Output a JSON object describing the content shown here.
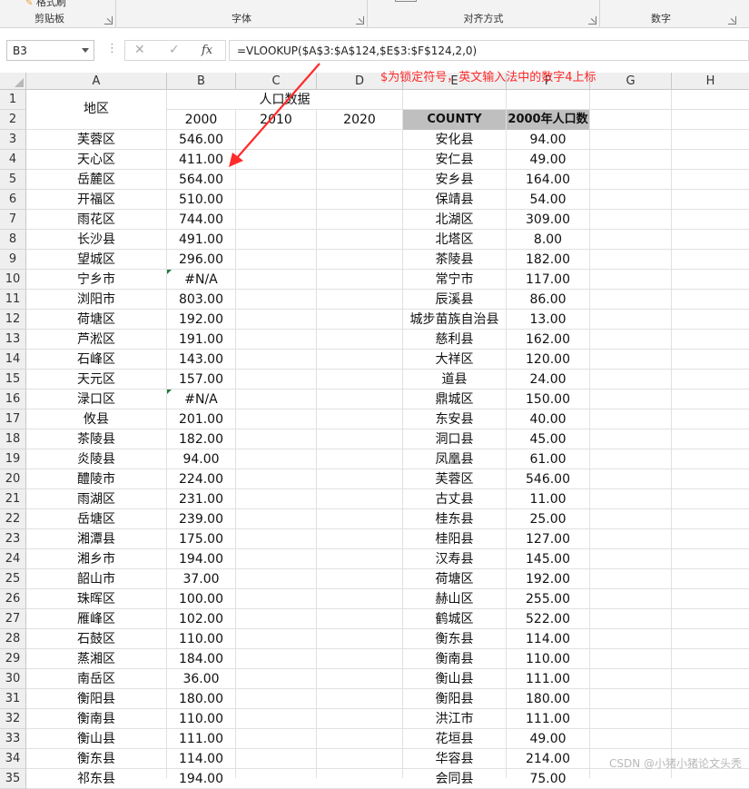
{
  "ribbon": {
    "clipboard_top": "格式刷",
    "groups": [
      {
        "label": "剪贴板"
      },
      {
        "label": "字体"
      },
      {
        "label": "对齐方式"
      },
      {
        "label": "数字"
      }
    ]
  },
  "formula_bar": {
    "name_box": "B3",
    "formula": "=VLOOKUP($A$3:$A$124,$E$3:$F$124,2,0)",
    "cancel_icon": "✕",
    "enter_icon": "✓",
    "fx_label": "fx"
  },
  "annotation": "$为锁定符号，英文输入法中的数字4上标",
  "columns": [
    "A",
    "B",
    "C",
    "D",
    "E",
    "F",
    "G",
    "H"
  ],
  "rows": [
    "1",
    "2",
    "3",
    "4",
    "5",
    "6",
    "7",
    "8",
    "9",
    "10",
    "11",
    "12",
    "13",
    "14",
    "15",
    "16",
    "17",
    "18",
    "19",
    "20",
    "21",
    "22",
    "23",
    "24",
    "25",
    "26",
    "27",
    "28",
    "29",
    "30",
    "31",
    "32",
    "33",
    "34",
    "35"
  ],
  "headers": {
    "region": "地区",
    "population_data": "人口数据",
    "year_2000": "2000",
    "year_2010": "2010",
    "year_2020": "2020",
    "county": "COUNTY",
    "pop_2000": "2000年人口数"
  },
  "left_table": [
    [
      "芙蓉区",
      "546.00"
    ],
    [
      "天心区",
      "411.00"
    ],
    [
      "岳麓区",
      "564.00"
    ],
    [
      "开福区",
      "510.00"
    ],
    [
      "雨花区",
      "744.00"
    ],
    [
      "长沙县",
      "491.00"
    ],
    [
      "望城区",
      "296.00"
    ],
    [
      "宁乡市",
      "#N/A"
    ],
    [
      "浏阳市",
      "803.00"
    ],
    [
      "荷塘区",
      "192.00"
    ],
    [
      "芦淞区",
      "191.00"
    ],
    [
      "石峰区",
      "143.00"
    ],
    [
      "天元区",
      "157.00"
    ],
    [
      "渌口区",
      "#N/A"
    ],
    [
      "攸县",
      "201.00"
    ],
    [
      "茶陵县",
      "182.00"
    ],
    [
      "炎陵县",
      "94.00"
    ],
    [
      "醴陵市",
      "224.00"
    ],
    [
      "雨湖区",
      "231.00"
    ],
    [
      "岳塘区",
      "239.00"
    ],
    [
      "湘潭县",
      "175.00"
    ],
    [
      "湘乡市",
      "194.00"
    ],
    [
      "韶山市",
      "37.00"
    ],
    [
      "珠晖区",
      "100.00"
    ],
    [
      "雁峰区",
      "102.00"
    ],
    [
      "石鼓区",
      "110.00"
    ],
    [
      "蒸湘区",
      "184.00"
    ],
    [
      "南岳区",
      "36.00"
    ],
    [
      "衡阳县",
      "180.00"
    ],
    [
      "衡南县",
      "110.00"
    ],
    [
      "衡山县",
      "111.00"
    ],
    [
      "衡东县",
      "114.00"
    ],
    [
      "祁东县",
      "194.00"
    ]
  ],
  "right_table": [
    [
      "安化县",
      "94.00"
    ],
    [
      "安仁县",
      "49.00"
    ],
    [
      "安乡县",
      "164.00"
    ],
    [
      "保靖县",
      "54.00"
    ],
    [
      "北湖区",
      "309.00"
    ],
    [
      "北塔区",
      "8.00"
    ],
    [
      "茶陵县",
      "182.00"
    ],
    [
      "常宁市",
      "117.00"
    ],
    [
      "辰溪县",
      "86.00"
    ],
    [
      "城步苗族自治县",
      "13.00"
    ],
    [
      "慈利县",
      "162.00"
    ],
    [
      "大祥区",
      "120.00"
    ],
    [
      "道县",
      "24.00"
    ],
    [
      "鼎城区",
      "150.00"
    ],
    [
      "东安县",
      "40.00"
    ],
    [
      "洞口县",
      "45.00"
    ],
    [
      "凤凰县",
      "61.00"
    ],
    [
      "芙蓉区",
      "546.00"
    ],
    [
      "古丈县",
      "11.00"
    ],
    [
      "桂东县",
      "25.00"
    ],
    [
      "桂阳县",
      "127.00"
    ],
    [
      "汉寿县",
      "145.00"
    ],
    [
      "荷塘区",
      "192.00"
    ],
    [
      "赫山区",
      "255.00"
    ],
    [
      "鹤城区",
      "522.00"
    ],
    [
      "衡东县",
      "114.00"
    ],
    [
      "衡南县",
      "110.00"
    ],
    [
      "衡山县",
      "111.00"
    ],
    [
      "衡阳县",
      "180.00"
    ],
    [
      "洪江市",
      "111.00"
    ],
    [
      "花垣县",
      "49.00"
    ],
    [
      "华容县",
      "214.00"
    ],
    [
      "会同县",
      "75.00"
    ]
  ],
  "watermark": "CSDN @小猪小猪论文头秃",
  "colors": {
    "accent": "#217346",
    "annotation": "#ff2a2a",
    "header_fill": "#bfbfbf",
    "error_triangle": "#1e7b34"
  }
}
